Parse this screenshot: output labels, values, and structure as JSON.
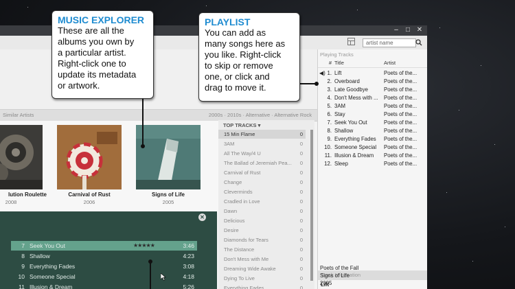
{
  "window": {
    "minimize_glyph": "–",
    "maximize_glyph": "□",
    "close_glyph": "✕"
  },
  "search": {
    "value": "artist name"
  },
  "similar_bar": {
    "label": "Similar Artists",
    "tags": "2000s  ·  2010s  ·  Alternative  ·  Alternative Rock"
  },
  "albums": [
    {
      "title": "lution Roulette",
      "year": "2008"
    },
    {
      "title": "Carnival of Rust",
      "year": "2006"
    },
    {
      "title": "Signs of Life",
      "year": "2005"
    }
  ],
  "album_tracks": [
    {
      "num": "7",
      "title": "Seek You Out",
      "rating": "★★★★★",
      "time": "3:46",
      "selected": true
    },
    {
      "num": "8",
      "title": "Shallow",
      "rating": "",
      "time": "4:23"
    },
    {
      "num": "9",
      "title": "Everything Fades",
      "rating": "",
      "time": "3:08"
    },
    {
      "num": "10",
      "title": "Someone Special",
      "rating": "",
      "time": "4:18"
    },
    {
      "num": "11",
      "title": "Illusion & Dream",
      "rating": "",
      "time": "5:26"
    }
  ],
  "top_tracks": {
    "header": "TOP TRACKS  ▾",
    "items": [
      {
        "name": "15 Min Flame",
        "count": "0"
      },
      {
        "name": "3AM",
        "count": "0"
      },
      {
        "name": "All The Way/4 U",
        "count": "0"
      },
      {
        "name": "The Ballad of Jeremiah Pea...",
        "count": "0"
      },
      {
        "name": "Carnival of Rust",
        "count": "0"
      },
      {
        "name": "Change",
        "count": "0"
      },
      {
        "name": "Cleverminds",
        "count": "0"
      },
      {
        "name": "Cradled in Love",
        "count": "0"
      },
      {
        "name": "Dawn",
        "count": "0"
      },
      {
        "name": "Delicious",
        "count": "0"
      },
      {
        "name": "Desire",
        "count": "0"
      },
      {
        "name": "Diamonds for Tears",
        "count": "0"
      },
      {
        "name": "The Distance",
        "count": "0"
      },
      {
        "name": "Don't Mess with Me",
        "count": "0"
      },
      {
        "name": "Dreaming Wide Awake",
        "count": "0"
      },
      {
        "name": "Dying To Live",
        "count": "0"
      },
      {
        "name": "Everything Fades",
        "count": "0"
      }
    ]
  },
  "playlist": {
    "header": "Playing Tracks",
    "col_num": "#",
    "col_title": "Title",
    "col_artist": "Artist",
    "tracks": [
      {
        "num": "1.",
        "title": "Lift",
        "artist": "Poets of the..."
      },
      {
        "num": "2.",
        "title": "Overboard",
        "artist": "Poets of the..."
      },
      {
        "num": "3.",
        "title": "Late Goodbye",
        "artist": "Poets of the..."
      },
      {
        "num": "4.",
        "title": "Don't Mess with ...",
        "artist": "Poets of the..."
      },
      {
        "num": "5.",
        "title": "3AM",
        "artist": "Poets of the..."
      },
      {
        "num": "6.",
        "title": "Stay",
        "artist": "Poets of the..."
      },
      {
        "num": "7.",
        "title": "Seek You Out",
        "artist": "Poets of the..."
      },
      {
        "num": "8.",
        "title": "Shallow",
        "artist": "Poets of the..."
      },
      {
        "num": "9.",
        "title": "Everything Fades",
        "artist": "Poets of the..."
      },
      {
        "num": "10.",
        "title": "Someone Special",
        "artist": "Poets of the..."
      },
      {
        "num": "11.",
        "title": "Illusion & Dream",
        "artist": "Poets of the..."
      },
      {
        "num": "12.",
        "title": "Sleep",
        "artist": "Poets of the..."
      }
    ]
  },
  "track_info": {
    "header": "Track Information",
    "title": "Lift",
    "artist": "Poets of the Fall",
    "album": "Signs of Life",
    "year": "2005"
  },
  "callouts": {
    "music_explorer": {
      "title": "MUSIC EXPLORER",
      "lines": [
        "These are all the",
        "albums you own by",
        "a particular artist.",
        "Right-click one to",
        "update its metadata",
        "or artwork."
      ]
    },
    "playlist": {
      "title": "PLAYLIST",
      "lines": [
        "You can add as",
        "many songs here as",
        "you like. Right-click",
        "to skip or remove",
        "one, or click and",
        "drag to move it."
      ]
    }
  },
  "colors": {
    "accent": "#1e8bd0",
    "selection": "#64a28c",
    "tracklist_bg": "#2d4c43"
  }
}
